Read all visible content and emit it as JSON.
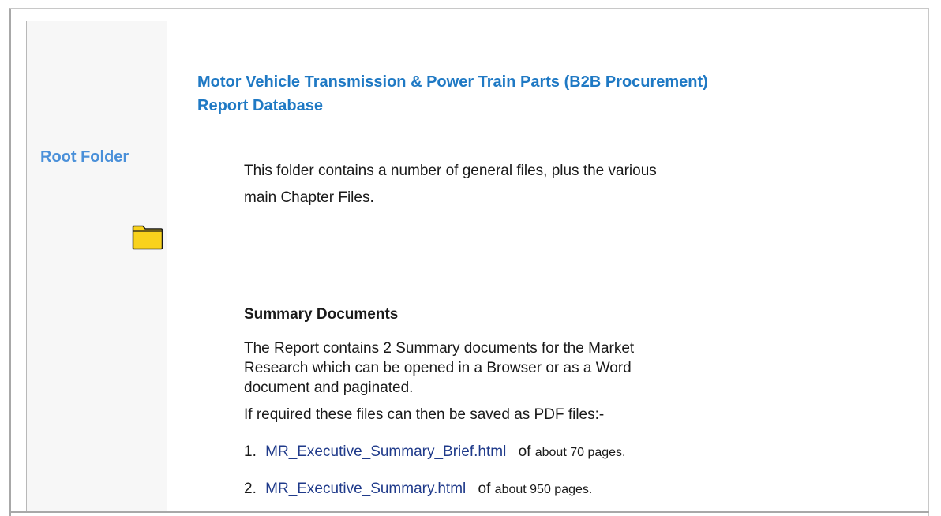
{
  "sidebar": {
    "label": "Root Folder",
    "folder_icon": "folder-icon",
    "folder_color": "#f9d21c"
  },
  "header": {
    "title_line1": "Motor Vehicle Transmission & Power Train Parts (B2B Procurement)",
    "title_line2": "Report Database"
  },
  "intro": {
    "line1": "This folder contains a number of general files, plus the various",
    "line2": "main Chapter Files."
  },
  "summary": {
    "heading": "Summary Documents",
    "line1": "The Report contains 2 Summary documents for the Market",
    "line2": "Research which can be opened in a Browser or as a Word",
    "line3": "document and paginated.",
    "pdf_note": "If required these files can then be saved as PDF files:-",
    "items": [
      {
        "number": "1.",
        "link": "MR_Executive_Summary_Brief.html",
        "of": "of",
        "pages": "about 70 pages."
      },
      {
        "number": "2.",
        "link": "MR_Executive_Summary.html",
        "of": "of",
        "pages": "about 950 pages."
      }
    ]
  },
  "colors": {
    "title": "#1f79c4",
    "sidebar_label": "#4a90d9",
    "link": "#1f3a8a",
    "sidebar_bg": "#f7f7f7"
  }
}
